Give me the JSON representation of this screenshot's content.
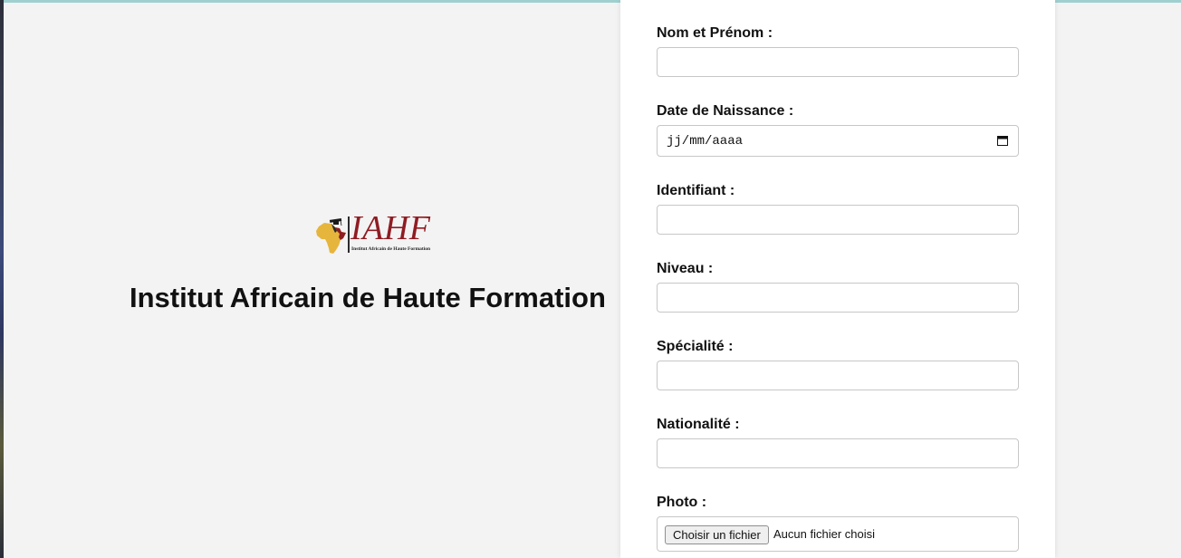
{
  "brand": {
    "logo_text": "IAHF",
    "logo_subtitle": "Institut Africain de Haute Formation",
    "institute_name": "Institut Africain de Haute Formation",
    "colors": {
      "logo_red": "#8f1c22",
      "map_gold": "#e6b53c"
    }
  },
  "form": {
    "fields": {
      "nom": {
        "label": "Nom et Prénom :",
        "value": ""
      },
      "date_naissance": {
        "label": "Date de Naissance :",
        "placeholder": "jj/mm/aaaa",
        "icon": "calendar-icon"
      },
      "identifiant": {
        "label": "Identifiant :",
        "value": ""
      },
      "niveau": {
        "label": "Niveau :",
        "value": ""
      },
      "specialite": {
        "label": "Spécialité :",
        "value": ""
      },
      "nationalite": {
        "label": "Nationalité :",
        "value": ""
      },
      "photo": {
        "label": "Photo :",
        "button_label": "Choisir un fichier",
        "status": "Aucun fichier choisi"
      }
    }
  }
}
